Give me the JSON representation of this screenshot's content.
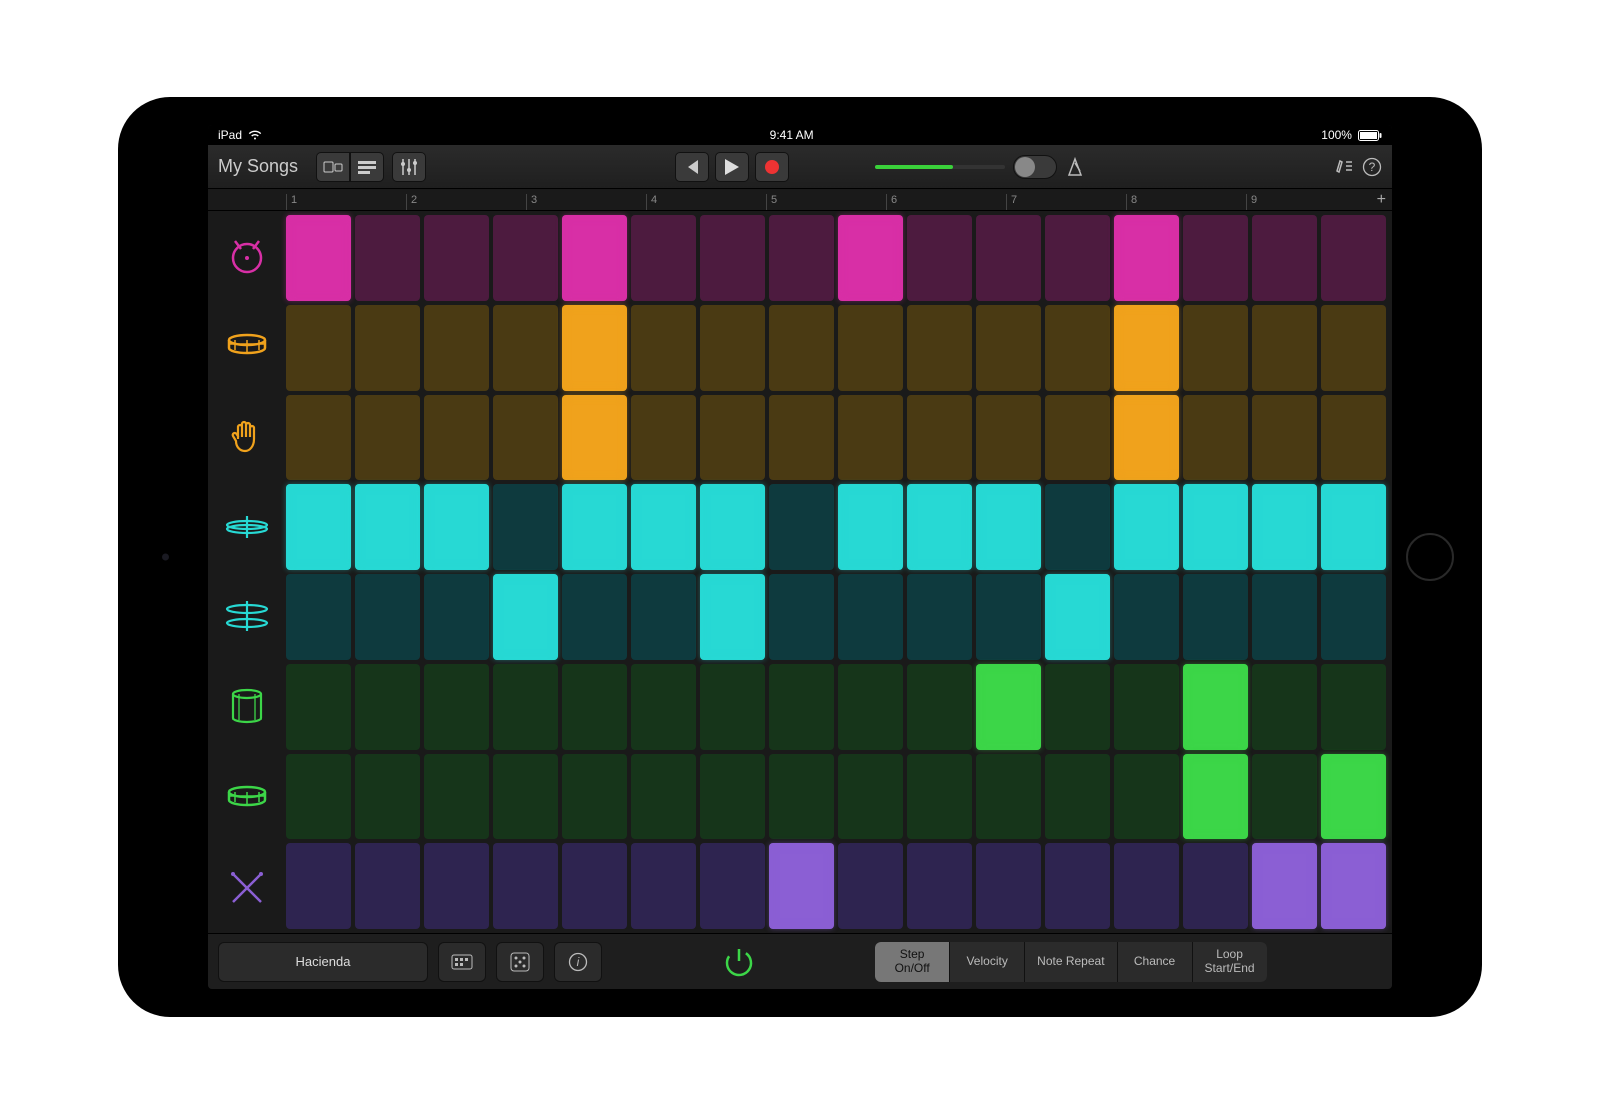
{
  "status": {
    "device": "iPad",
    "time": "9:41 AM",
    "battery": "100%"
  },
  "header": {
    "back_label": "My Songs"
  },
  "ruler": {
    "bars": [
      "1",
      "2",
      "3",
      "4",
      "5",
      "6",
      "7",
      "8",
      "9"
    ]
  },
  "tracks": [
    {
      "name": "kick",
      "color": "magenta",
      "icon": "kick-icon",
      "steps": [
        1,
        0,
        0,
        0,
        1,
        0,
        0,
        0,
        1,
        0,
        0,
        0,
        1,
        0,
        0,
        0
      ]
    },
    {
      "name": "snare",
      "color": "amber",
      "icon": "snare-icon",
      "steps": [
        0,
        0,
        0,
        0,
        1,
        0,
        0,
        0,
        0,
        0,
        0,
        0,
        1,
        0,
        0,
        0
      ]
    },
    {
      "name": "clap",
      "color": "amber",
      "icon": "hand-icon",
      "steps": [
        0,
        0,
        0,
        0,
        1,
        0,
        0,
        0,
        0,
        0,
        0,
        0,
        1,
        0,
        0,
        0
      ]
    },
    {
      "name": "hihat-closed",
      "color": "cyan",
      "icon": "hihat-closed-icon",
      "steps": [
        1,
        1,
        1,
        0,
        1,
        1,
        1,
        0,
        1,
        1,
        1,
        0,
        1,
        1,
        1,
        1
      ]
    },
    {
      "name": "hihat-open",
      "color": "cyan",
      "icon": "hihat-open-icon",
      "steps": [
        0,
        0,
        0,
        1,
        0,
        0,
        1,
        0,
        0,
        0,
        0,
        1,
        0,
        0,
        0,
        0
      ]
    },
    {
      "name": "tom",
      "color": "green",
      "icon": "tom-icon",
      "steps": [
        0,
        0,
        0,
        0,
        0,
        0,
        0,
        0,
        0,
        0,
        1,
        0,
        0,
        1,
        0,
        0
      ]
    },
    {
      "name": "floor-tom",
      "color": "green",
      "icon": "floortom-icon",
      "steps": [
        0,
        0,
        0,
        0,
        0,
        0,
        0,
        0,
        0,
        0,
        0,
        0,
        0,
        1,
        0,
        1
      ]
    },
    {
      "name": "sticks",
      "color": "purple",
      "icon": "sticks-icon",
      "steps": [
        0,
        0,
        0,
        0,
        0,
        0,
        0,
        1,
        0,
        0,
        0,
        0,
        0,
        0,
        1,
        1
      ]
    }
  ],
  "footer": {
    "preset": "Hacienda",
    "modes": [
      "Step\nOn/Off",
      "Velocity",
      "Note Repeat",
      "Chance",
      "Loop\nStart/End"
    ],
    "active_mode": 0
  },
  "colors": {
    "magenta": "#d82fa6",
    "amber": "#f0a21c",
    "cyan": "#27d9d4",
    "green": "#3cd648",
    "purple": "#8b5fd4"
  }
}
